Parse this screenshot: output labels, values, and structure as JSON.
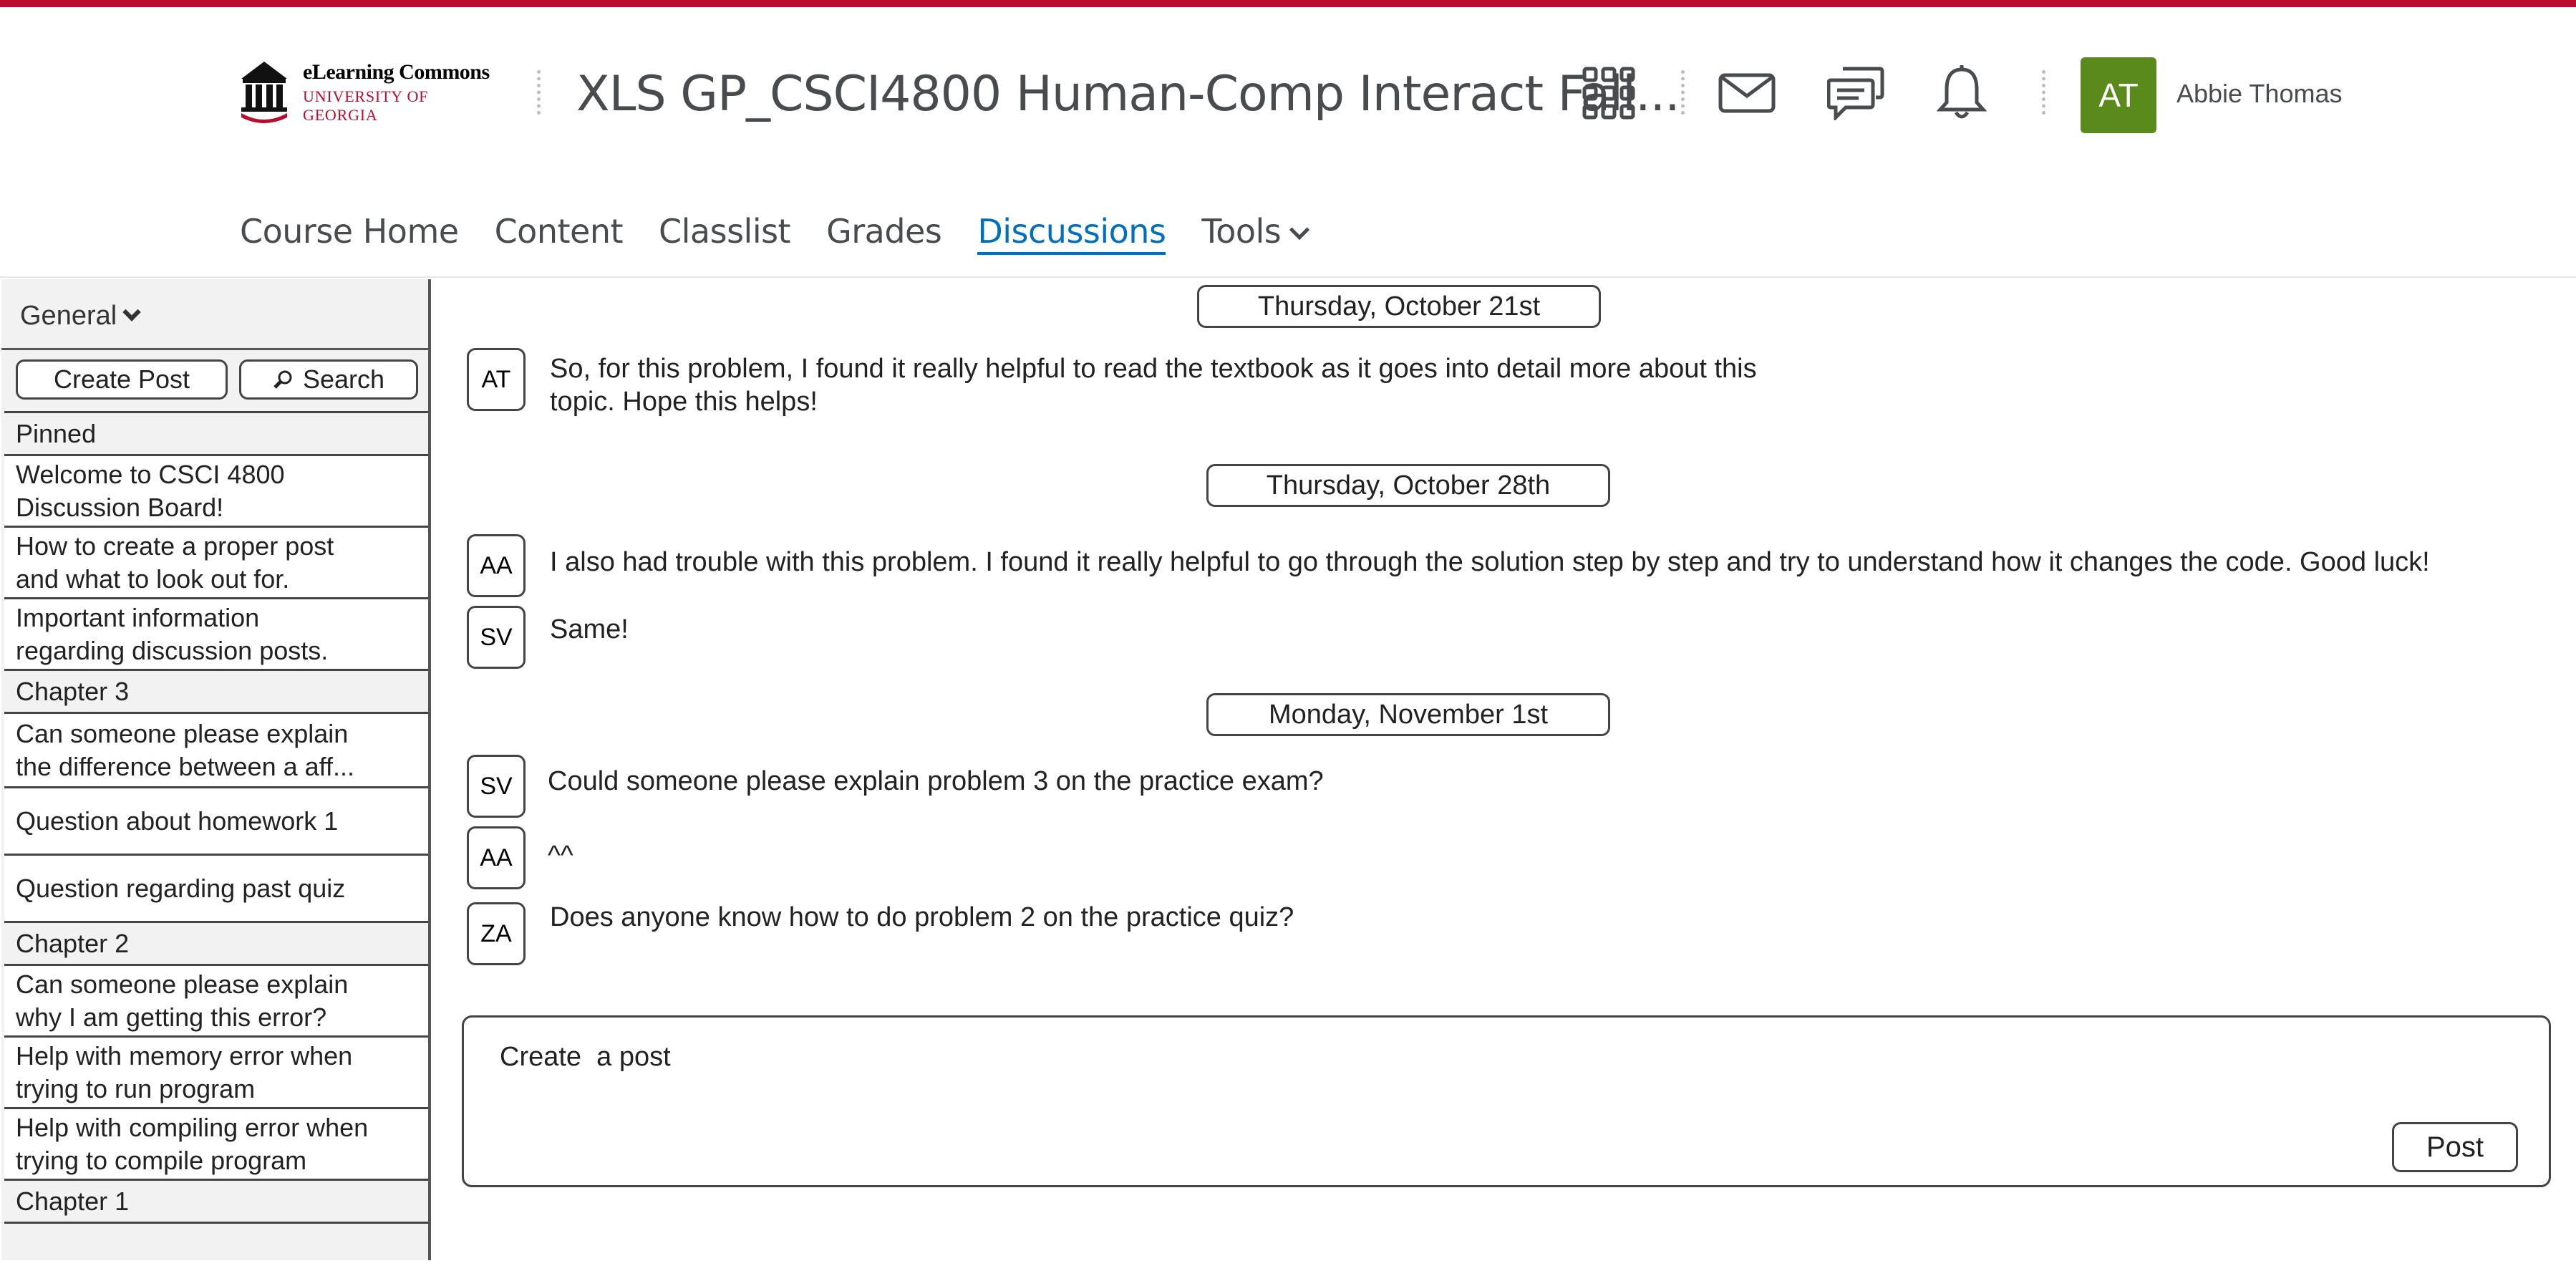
{
  "brand": {
    "line1": "eLearning Commons",
    "line2": "UNIVERSITY OF GEORGIA",
    "accent_color": "#ba0c2f"
  },
  "header": {
    "course_title": "XLS GP_CSCI4800 Human-Comp Interact Fall...",
    "icons": [
      "apps-grid-icon",
      "mail-icon",
      "chat-icon",
      "bell-icon"
    ],
    "user": {
      "initials": "AT",
      "name": "Abbie Thomas",
      "avatar_color": "#5a8a1c"
    }
  },
  "nav": {
    "items": [
      "Course Home",
      "Content",
      "Classlist",
      "Grades",
      "Discussions",
      "Tools"
    ],
    "active": "Discussions"
  },
  "sidebar": {
    "filter": "General",
    "create_label": "Create Post",
    "search_label": "Search",
    "rows": [
      {
        "text": "Pinned",
        "section": true
      },
      {
        "text": "Welcome to CSCI 4800\nDiscussion Board!"
      },
      {
        "text": "How to create a proper post\nand what to look out for."
      },
      {
        "text": "Important information\nregarding discussion posts."
      },
      {
        "text": "Chapter 3",
        "section": true
      },
      {
        "text": "Can someone please explain\nthe difference between a aff..."
      },
      {
        "text": "Question about homework 1"
      },
      {
        "text": "Question regarding past quiz"
      },
      {
        "text": "Chapter 2",
        "section": true
      },
      {
        "text": "Can someone please explain\nwhy I am getting this error?"
      },
      {
        "text": "Help with memory error when\ntrying to run program"
      },
      {
        "text": "Help with compiling error when\ntrying to compile program"
      },
      {
        "text": "Chapter 1",
        "section": true
      }
    ]
  },
  "feed": {
    "dates": [
      "Thursday, October 21st",
      "Thursday, October 28th",
      "Monday, November 1st"
    ],
    "messages": [
      {
        "initials": "AT",
        "text": "So, for this problem, I found it really helpful to read the textbook as it goes into detail more about this\ntopic. Hope this helps!"
      },
      {
        "initials": "AA",
        "text": "I also had trouble with this problem. I found it really helpful to go through the solution step by step and try to understand how it changes the code. Good luck!"
      },
      {
        "initials": "SV",
        "text": "Same!"
      },
      {
        "initials": "SV",
        "text": "Could someone please explain problem 3 on the practice exam?"
      },
      {
        "initials": "AA",
        "text": "^^"
      },
      {
        "initials": "ZA",
        "text": "Does anyone know how to do problem 2 on the practice quiz?"
      }
    ]
  },
  "composer": {
    "placeholder": "Create  a post",
    "post_label": "Post"
  }
}
